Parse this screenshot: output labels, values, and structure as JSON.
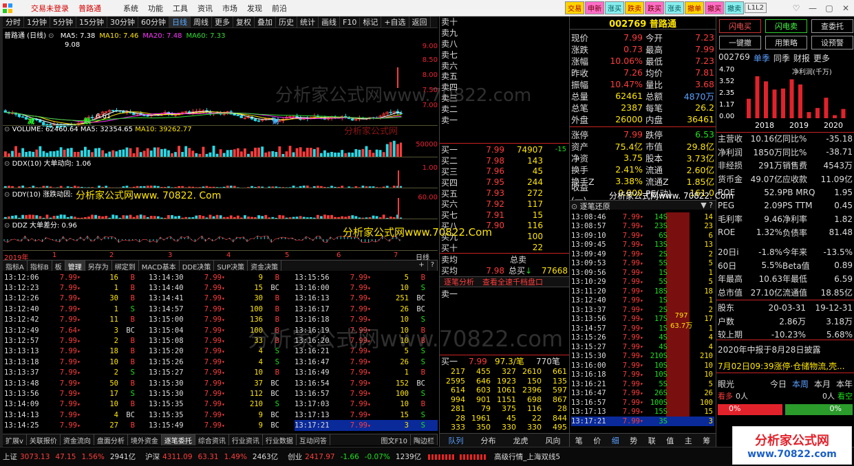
{
  "titlebar": {
    "items": [
      "交易未登录",
      "普路通",
      "系统",
      "功能",
      "工具",
      "资讯",
      "市场",
      "发现",
      "前沿"
    ],
    "tags": [
      "交易",
      "申新",
      "涨买",
      "跌卖",
      "跌买",
      "涨卖",
      "撤单",
      "撤买",
      "撤卖",
      "L1L2"
    ]
  },
  "chart": {
    "toolbar": [
      "分时",
      "1分钟",
      "5分钟",
      "15分钟",
      "30分钟",
      "60分钟",
      "日线",
      "周线",
      "更多",
      "复权",
      "叠加",
      "历史",
      "统计",
      "画线",
      "F10",
      "标记",
      "+自选",
      "返回"
    ],
    "title": "普路通 (日线)",
    "ma": [
      {
        "label": "MA5: 7.38",
        "color": "#ffffff"
      },
      {
        "label": "MA10: 7.46",
        "color": "#ffe600"
      },
      {
        "label": "MA20: 7.48",
        "color": "#ff33ff"
      },
      {
        "label": "MA60: 7.33",
        "color": "#33dd33"
      }
    ],
    "price_axis": [
      "9.00",
      "8.50",
      "8.00",
      "7.50",
      "7.00"
    ],
    "price_high": "9.08",
    "price_low": "6.61",
    "marks": [
      "减",
      "跌",
      "财"
    ],
    "volume": {
      "title": "VOLUME: 62460.64",
      "ma5": "MA5: 32354.65",
      "ma10": "MA10: 39262.77",
      "axis": "50000"
    },
    "ddx": {
      "title": "DDX(10) 大单动向: 1.06",
      "axis": "1.00"
    },
    "ddy": {
      "title": "DDY(10) 涨跌动因:",
      "axis": "60.00"
    },
    "ddz": {
      "title": "DDZ 大单差分: 0.96"
    },
    "x_axis": [
      "2019年",
      "1",
      "2",
      "3",
      "4",
      "5",
      "6",
      "7"
    ],
    "period": "日线"
  },
  "indicator_tabs": [
    "指标A",
    "指标B",
    "板",
    "管理",
    "另存为",
    "绑定到",
    "MACD基本",
    "DDE决策",
    "SUP决策",
    "资金决策"
  ],
  "ticks": {
    "col1": [
      [
        "13:12:06",
        "7.99",
        "16",
        "B"
      ],
      [
        "13:12:23",
        "7.99",
        "1",
        "B"
      ],
      [
        "13:12:26",
        "7.99",
        "30",
        "B"
      ],
      [
        "13:12:40",
        "7.99",
        "1",
        "S"
      ],
      [
        "13:12:42",
        "7.99",
        "11",
        "B"
      ],
      [
        "13:12:49",
        "7.64",
        "3",
        "BC"
      ],
      [
        "13:12:57",
        "7.99",
        "2",
        "B"
      ],
      [
        "13:13:13",
        "7.99",
        "18",
        "B"
      ],
      [
        "13:13:18",
        "7.99",
        "10",
        "B"
      ],
      [
        "13:13:37",
        "7.99",
        "2",
        "S"
      ],
      [
        "13:13:48",
        "7.99",
        "50",
        "B"
      ],
      [
        "13:13:56",
        "7.99",
        "17",
        "S"
      ],
      [
        "13:14:09",
        "7.99",
        "10",
        "B"
      ],
      [
        "13:14:13",
        "7.99",
        "4",
        "BC"
      ],
      [
        "13:14:25",
        "7.99",
        "27",
        "B"
      ]
    ],
    "col2": [
      [
        "13:14:30",
        "7.99",
        "9",
        "B"
      ],
      [
        "13:14:40",
        "7.99",
        "15",
        "BC"
      ],
      [
        "13:14:41",
        "7.99",
        "30",
        "B"
      ],
      [
        "13:14:57",
        "7.99",
        "100",
        "B"
      ],
      [
        "13:15:00",
        "7.99",
        "136",
        "B"
      ],
      [
        "13:15:04",
        "7.99",
        "100",
        "B"
      ],
      [
        "13:15:08",
        "7.99",
        "33",
        "B"
      ],
      [
        "13:15:20",
        "7.99",
        "4",
        "S"
      ],
      [
        "13:15:26",
        "7.99",
        "4",
        "S"
      ],
      [
        "13:15:27",
        "7.99",
        "10",
        "B"
      ],
      [
        "13:15:30",
        "7.99",
        "37",
        "BC"
      ],
      [
        "13:15:30",
        "7.99",
        "112",
        "BC"
      ],
      [
        "13:15:35",
        "7.99",
        "210",
        "S"
      ],
      [
        "13:15:35",
        "7.99",
        "9",
        "BC"
      ],
      [
        "13:15:49",
        "7.99",
        "9",
        "BC"
      ]
    ],
    "col3": [
      [
        "13:15:56",
        "7.99",
        "5",
        "B"
      ],
      [
        "13:16:00",
        "7.99",
        "10",
        "S"
      ],
      [
        "13:16:13",
        "7.99",
        "251",
        "BC"
      ],
      [
        "13:16:17",
        "7.99",
        "26",
        "BC"
      ],
      [
        "13:16:18",
        "7.99",
        "10",
        "S"
      ],
      [
        "13:16:19",
        "7.99",
        "10",
        "B"
      ],
      [
        "13:16:20",
        "7.99",
        "10",
        "B"
      ],
      [
        "13:16:21",
        "7.99",
        "5",
        "S"
      ],
      [
        "13:16:47",
        "7.99",
        "26",
        "S"
      ],
      [
        "13:16:49",
        "7.99",
        "1",
        "B"
      ],
      [
        "13:16:54",
        "7.99",
        "152",
        "BC"
      ],
      [
        "13:16:57",
        "7.99",
        "100",
        "S"
      ],
      [
        "13:17:03",
        "7.99",
        "10",
        "B"
      ],
      [
        "13:17:13",
        "7.99",
        "15",
        "S"
      ],
      [
        "13:17:21",
        "7.99",
        "3",
        "S"
      ]
    ]
  },
  "bottomtabs": [
    "扩展v",
    "关联报价",
    "资金流向",
    "盘面分析",
    "境外资金",
    "逐笔委托",
    "综合资讯",
    "行业资讯",
    "行业数据",
    "互动问答",
    "图文F10",
    "陶边栏"
  ],
  "orderbook": {
    "sells": [
      "卖十",
      "卖九",
      "卖八",
      "卖七",
      "卖六",
      "卖五",
      "卖四",
      "卖三",
      "卖二",
      "卖一"
    ],
    "buys": [
      [
        "买一",
        "7.99",
        "74907",
        "-15"
      ],
      [
        "买二",
        "7.98",
        "143",
        ""
      ],
      [
        "买三",
        "7.96",
        "45",
        ""
      ],
      [
        "买四",
        "7.95",
        "244",
        ""
      ],
      [
        "买五",
        "7.93",
        "272",
        ""
      ],
      [
        "买六",
        "7.92",
        "117",
        ""
      ],
      [
        "买七",
        "7.91",
        "15",
        ""
      ],
      [
        "买八",
        "7.90",
        "116",
        ""
      ],
      [
        "买九",
        "",
        "100",
        ""
      ],
      [
        "买十",
        "",
        "22",
        ""
      ]
    ],
    "avg": {
      "sell_label": "卖均",
      "sell_total": "总卖",
      "buy_label": "买均",
      "buy_avg": "7.98",
      "buy_total_label": "总买",
      "buy_total": "77668"
    },
    "tabs": [
      "逐笔分析",
      "查看全速千档盘口"
    ],
    "sell1": "卖一",
    "queue": {
      "header": [
        "买一",
        "7.99",
        "97.3/笔",
        "770笔"
      ],
      "rows": [
        [
          "217",
          "455",
          "327",
          "2610",
          "661"
        ],
        [
          "2595",
          "646",
          "1923",
          "150",
          "135"
        ],
        [
          "614",
          "603",
          "1061",
          "2396",
          "597"
        ],
        [
          "994",
          "901",
          "1151",
          "698",
          "867"
        ],
        [
          "281",
          "79",
          "375",
          "116",
          "28"
        ],
        [
          "28",
          "1961",
          "45",
          "22",
          "844"
        ],
        [
          "333",
          "350",
          "330",
          "330",
          "495"
        ]
      ]
    },
    "tabs2": [
      "队列",
      "分布",
      "龙虎",
      "风向"
    ]
  },
  "quote": {
    "code": "002769",
    "name": "普路通",
    "rows": [
      [
        "现价",
        "7.99",
        "今开",
        "7.23"
      ],
      [
        "涨跌",
        "0.73",
        "最高",
        "7.99"
      ],
      [
        "涨幅",
        "10.06%",
        "最低",
        "7.23"
      ],
      [
        "昨收",
        "7.26",
        "均价",
        "7.81"
      ],
      [
        "振幅",
        "10.47%",
        "量比",
        "3.68"
      ],
      [
        "总量",
        "62461",
        "总额",
        "4870万"
      ],
      [
        "总笔",
        "2387",
        "每笔",
        "26.2"
      ],
      [
        "外盘",
        "26000",
        "内盘",
        "36461"
      ]
    ],
    "rows2": [
      [
        "涨停",
        "7.99",
        "跌停",
        "6.53"
      ],
      [
        "资产",
        "75.4亿",
        "市值",
        "29.8亿"
      ],
      [
        "净资",
        "3.75",
        "股本",
        "3.73亿"
      ],
      [
        "换手",
        "2.41%",
        "流通",
        "2.60亿"
      ],
      [
        "换手Z",
        "3.38%",
        "流通Z",
        "1.85亿"
      ],
      [
        "收益(一)",
        "0.000",
        "PE(动)",
        "161.0"
      ]
    ]
  },
  "trades": {
    "title": "逐笔还原",
    "rows": [
      [
        "13:08:46",
        "7.99",
        "14S",
        "14"
      ],
      [
        "13:08:57",
        "7.99",
        "23S",
        "23"
      ],
      [
        "13:09:10",
        "7.99",
        "6S",
        "6"
      ],
      [
        "13:09:45",
        "7.99",
        "13S",
        "13"
      ],
      [
        "13:09:49",
        "7.99",
        "2S",
        "2"
      ],
      [
        "13:09:53",
        "7.99",
        "5S",
        "5"
      ],
      [
        "13:09:56",
        "7.99",
        "1S",
        "1"
      ],
      [
        "13:10:29",
        "7.99",
        "5S",
        "5"
      ],
      [
        "13:11:20",
        "7.99",
        "18S",
        "18"
      ],
      [
        "13:12:40",
        "7.99",
        "1S",
        "1"
      ],
      [
        "13:13:37",
        "7.99",
        "2S",
        "2"
      ],
      [
        "13:13:56",
        "7.99",
        "17S",
        "17"
      ],
      [
        "13:14:57",
        "7.99",
        "1S",
        "1"
      ],
      [
        "13:15:26",
        "7.99",
        "4S",
        "4"
      ],
      [
        "13:15:27",
        "7.99",
        "4S",
        "4"
      ],
      [
        "13:15:30",
        "7.99",
        "210S",
        "210"
      ],
      [
        "13:16:00",
        "7.99",
        "10S",
        "10"
      ],
      [
        "13:16:18",
        "7.99",
        "10S",
        "10"
      ],
      [
        "13:16:21",
        "7.99",
        "5S",
        "5"
      ],
      [
        "13:16:47",
        "7.99",
        "26S",
        "26"
      ],
      [
        "13:16:57",
        "7.99",
        "100S",
        "100"
      ],
      [
        "13:17:13",
        "7.99",
        "15S",
        "15"
      ],
      [
        "13:17:21",
        "7.99",
        "3S",
        "3"
      ]
    ],
    "bar_label1": "797",
    "bar_label2": "63.7万",
    "tabs": [
      "笔",
      "价",
      "细",
      "势",
      "联",
      "值",
      "主",
      "筹"
    ]
  },
  "right": {
    "buttons": [
      "闪电买",
      "闪电卖",
      "查委托",
      "一键撤",
      "用策略",
      "设预警"
    ],
    "code": "002769",
    "tabs": [
      "单季",
      "同季",
      "财报",
      "更多"
    ],
    "unit": "净利润(千万)",
    "chart_data": {
      "type": "bar",
      "y_ticks": [
        "4.70",
        "3.52",
        "2.35",
        "1.17",
        "0.00"
      ],
      "categories": [
        "2018",
        "2019",
        "2020"
      ],
      "values": [
        1.9,
        4.1,
        3.6,
        2.8,
        2.9,
        3.8,
        3.3,
        0.6,
        1.0,
        2.0,
        0.3,
        0.9
      ]
    },
    "fin": [
      [
        "主营收",
        "10.16亿",
        "同比%",
        "-35.18"
      ],
      [
        "净利润",
        "1850万",
        "同比%",
        "-38.71"
      ],
      [
        "非经损",
        "291万",
        "销售费",
        "4543万"
      ],
      [
        "货币金",
        "49.07亿",
        "应收款",
        "11.09亿"
      ],
      [
        "ROE",
        "52.9",
        "PB MRQ",
        "1.95"
      ],
      [
        "PEG",
        "2.09",
        "PS TTM",
        "0.45"
      ],
      [
        "毛利率",
        "9.46",
        "净利率",
        "1.82"
      ],
      [
        "ROE",
        "1.32%",
        "负债率",
        "81.48"
      ]
    ],
    "perf": [
      [
        "20日i",
        "-1.8%",
        "今年来",
        "-13.5%"
      ],
      [
        "60日",
        "5.5%",
        "Beta值",
        "0.89"
      ],
      [
        "年最高",
        "10.63",
        "年最低",
        "6.59"
      ],
      [
        "总市值",
        "27.10亿",
        "流通值",
        "18.85亿"
      ]
    ],
    "holders": [
      [
        "股东",
        "20-03-31",
        "19-12-31"
      ],
      [
        "户数",
        "2.86万",
        "3.18万"
      ],
      [
        "较上期",
        "-10.23%",
        "5.68%"
      ]
    ],
    "notice1": "2020年中报于8月28日披露",
    "notice2": "7月02日09:39涨停·仓储物流,壳...",
    "vision": {
      "label": "眼光",
      "tabs": [
        "今日",
        "本周",
        "本月",
        "本年"
      ],
      "bull": "看多",
      "bull_count": "0人",
      "bear_count": "0人",
      "bear": "看空",
      "bull_pct": "0%",
      "bear_pct": "0%"
    }
  },
  "status": {
    "sh_label": "上证",
    "sh": "3073.13",
    "sh_chg": "47.15",
    "sh_pct": "1.56%",
    "sh_amt": "2941亿",
    "hs_label": "沪深",
    "hs": "4311.09",
    "hs_chg": "63.31",
    "hs_pct": "1.49%",
    "hs_amt": "2463亿",
    "cy_label": "创业",
    "cy": "2417.97",
    "cy_chg": "-1.66",
    "cy_pct": "-0.07%",
    "cy_amt": "1239亿",
    "feed": "高级行情_上海双线5"
  },
  "watermark": {
    "big": "分析家公式网www.70822.com",
    "yellow1": "分析家公式网www. 70822. Com",
    "yellow2": "分析家公式网www.70822.Com",
    "red": "分析家公式网",
    "logo1": "分析家公式网",
    "logo2": "www.70822.com"
  }
}
